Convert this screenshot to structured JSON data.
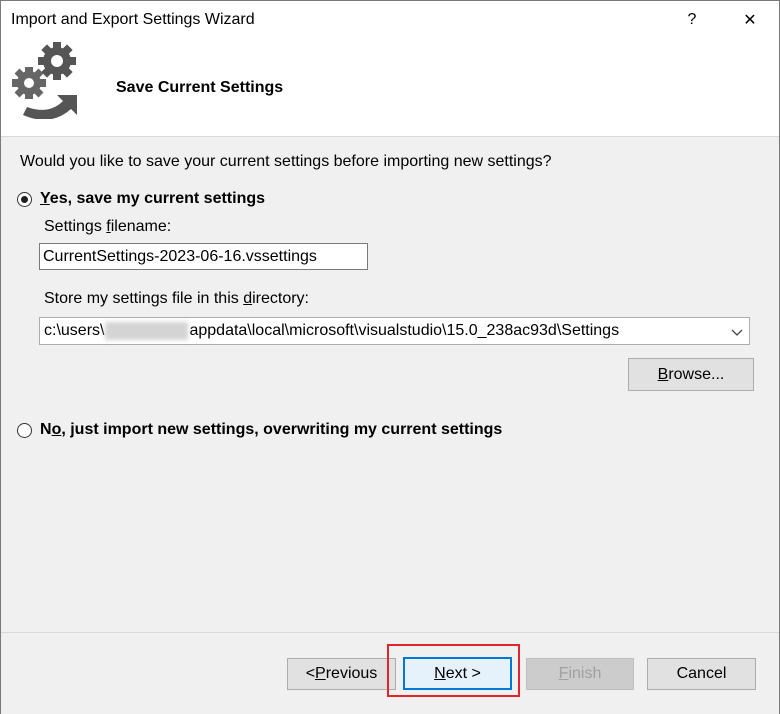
{
  "window": {
    "title": "Import and Export Settings Wizard",
    "help_glyph": "?",
    "close_glyph": "✕"
  },
  "header": {
    "title": "Save Current Settings",
    "icon": "gears-arrow-icon"
  },
  "question": "Would you like to save your current settings before importing new settings?",
  "option_yes": {
    "mnemonic": "Y",
    "rest": "es, save my current settings",
    "checked": true
  },
  "filename": {
    "label_pre": "Settings ",
    "label_mnemonic": "f",
    "label_post": "ilename:",
    "value": "CurrentSettings-2023-06-16.vssettings"
  },
  "directory": {
    "label_pre": "Store my settings file in this ",
    "label_mnemonic": "d",
    "label_post": "irectory:",
    "value_pre": "c:\\users\\",
    "value_post": "appdata\\local\\microsoft\\visualstudio\\15.0_238ac93d\\Settings"
  },
  "browse": {
    "mnemonic": "B",
    "rest": "rowse..."
  },
  "option_no": {
    "pre": "N",
    "mnemonic": "o",
    "rest": ", just import new settings, overwriting my current settings",
    "checked": false
  },
  "footer": {
    "previous": {
      "pre": "< ",
      "mnemonic": "P",
      "rest": "revious"
    },
    "next": {
      "mnemonic": "N",
      "rest": "ext >"
    },
    "finish": {
      "mnemonic": "F",
      "rest": "inish"
    },
    "cancel": "Cancel"
  },
  "colors": {
    "highlight": "#e0252b",
    "focus_border": "#0078d7",
    "window_bg": "#f0f0f0"
  }
}
